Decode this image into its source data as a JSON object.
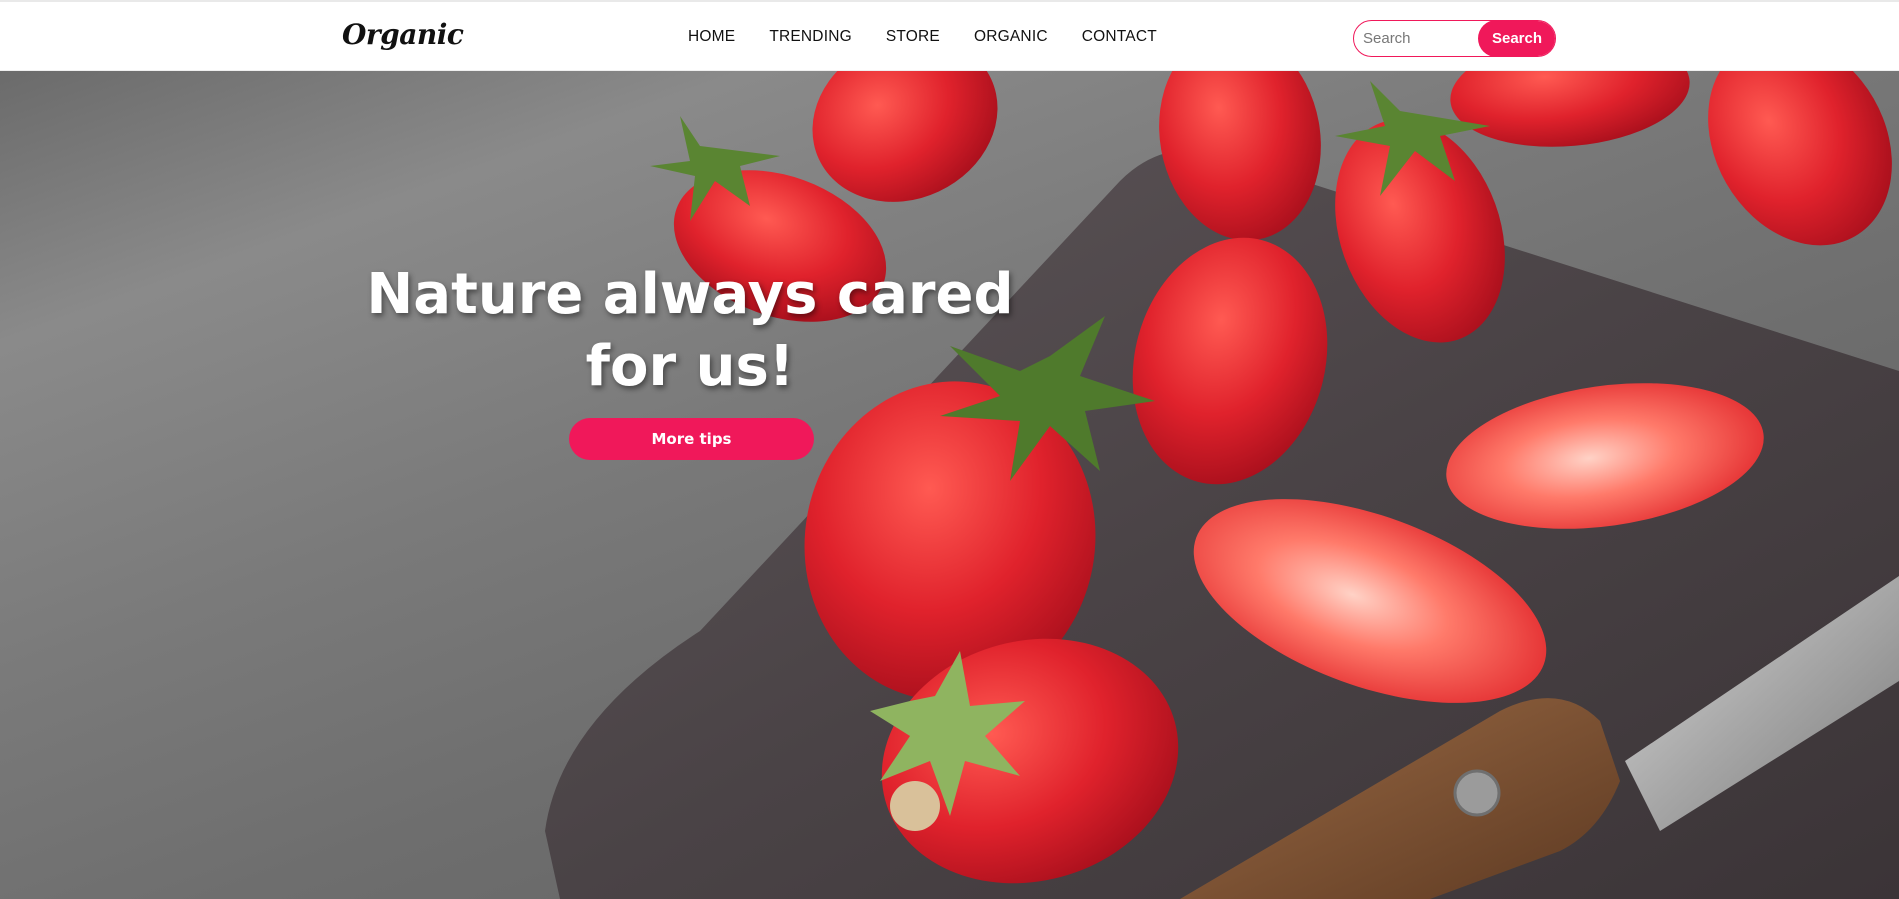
{
  "header": {
    "logo": "Organic",
    "nav": [
      "HOME",
      "TRENDING",
      "STORE",
      "ORGANIC",
      "CONTACT"
    ],
    "search": {
      "placeholder": "Search",
      "button_label": "Search"
    }
  },
  "hero": {
    "title": "Nature always cared for us!",
    "button_label": "More tips",
    "image": "strawberries-on-cutting-board-with-knife"
  },
  "colors": {
    "accent": "#f0185a",
    "background": "#ffffff",
    "text": "#111111"
  }
}
